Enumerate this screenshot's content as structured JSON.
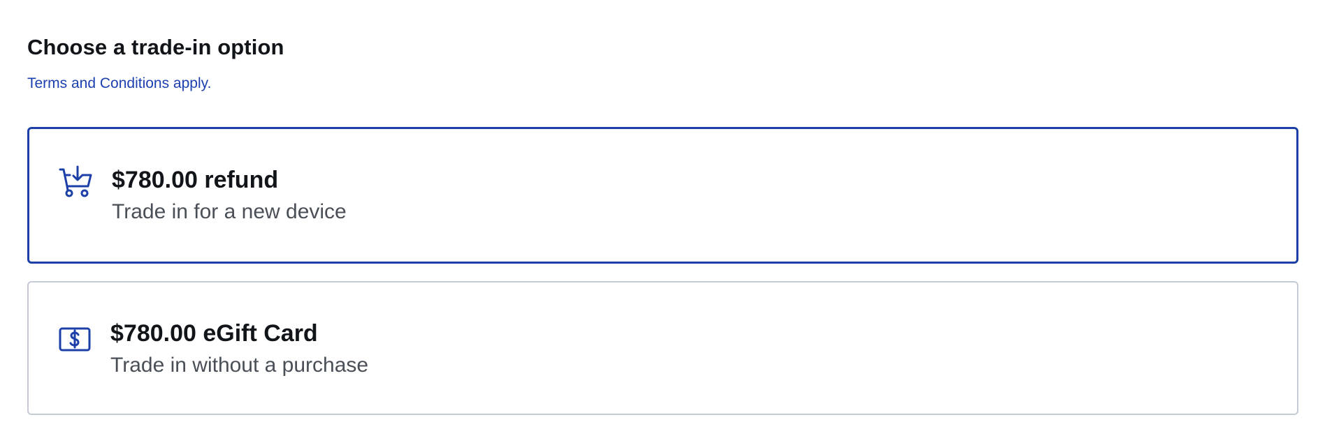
{
  "header": {
    "title": "Choose a trade-in option",
    "terms_link": "Terms and Conditions apply."
  },
  "options": [
    {
      "title": "$780.00 refund",
      "subtitle": "Trade in for a new device",
      "icon": "cart-download-icon",
      "selected": true
    },
    {
      "title": "$780.00 eGift Card",
      "subtitle": "Trade in without a purchase",
      "icon": "dollar-card-icon",
      "selected": false
    }
  ],
  "colors": {
    "accent": "#1d3fa8",
    "link": "#1d40b0",
    "border_unselected": "#c5cad6",
    "text_primary": "#111418",
    "text_secondary": "#4a4f57"
  }
}
